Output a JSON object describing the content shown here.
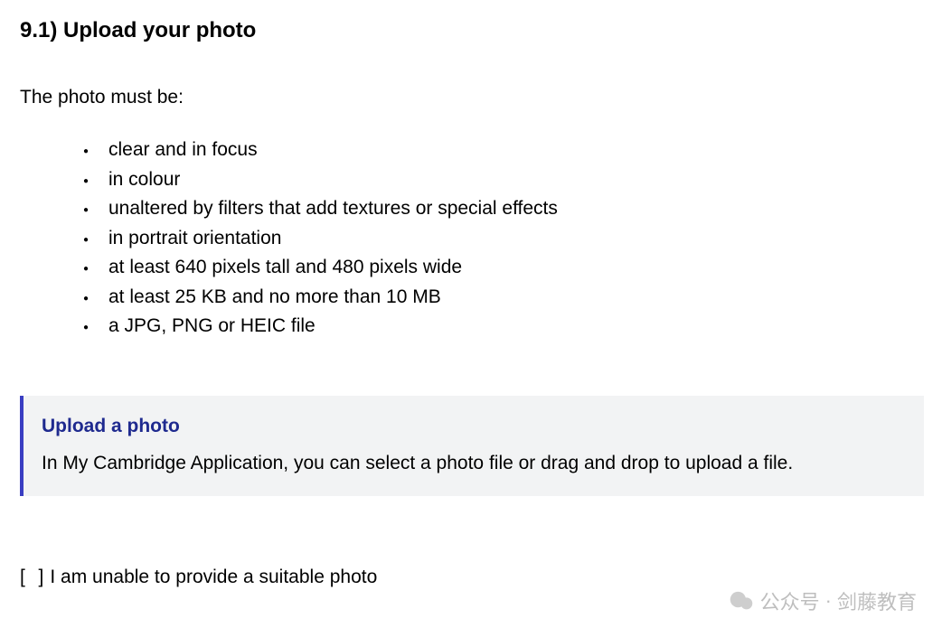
{
  "heading": "9.1) Upload your photo",
  "intro": "The photo must be:",
  "requirements": [
    "clear and in focus",
    "in colour",
    "unaltered by filters that add textures or special effects",
    "in portrait orientation",
    "at least 640 pixels tall and 480 pixels wide",
    "at least 25 KB and no more than 10 MB",
    "a JPG, PNG or HEIC file"
  ],
  "uploadBox": {
    "title": "Upload a photo",
    "description": "In My Cambridge Application, you can select a photo file or drag and drop to upload a file."
  },
  "checkbox": {
    "bracketLeft": "[",
    "bracketRight": "]",
    "label": "I am unable to provide a suitable photo"
  },
  "watermark": {
    "prefix": "公众号",
    "separator": "·",
    "name": "剑藤教育"
  }
}
